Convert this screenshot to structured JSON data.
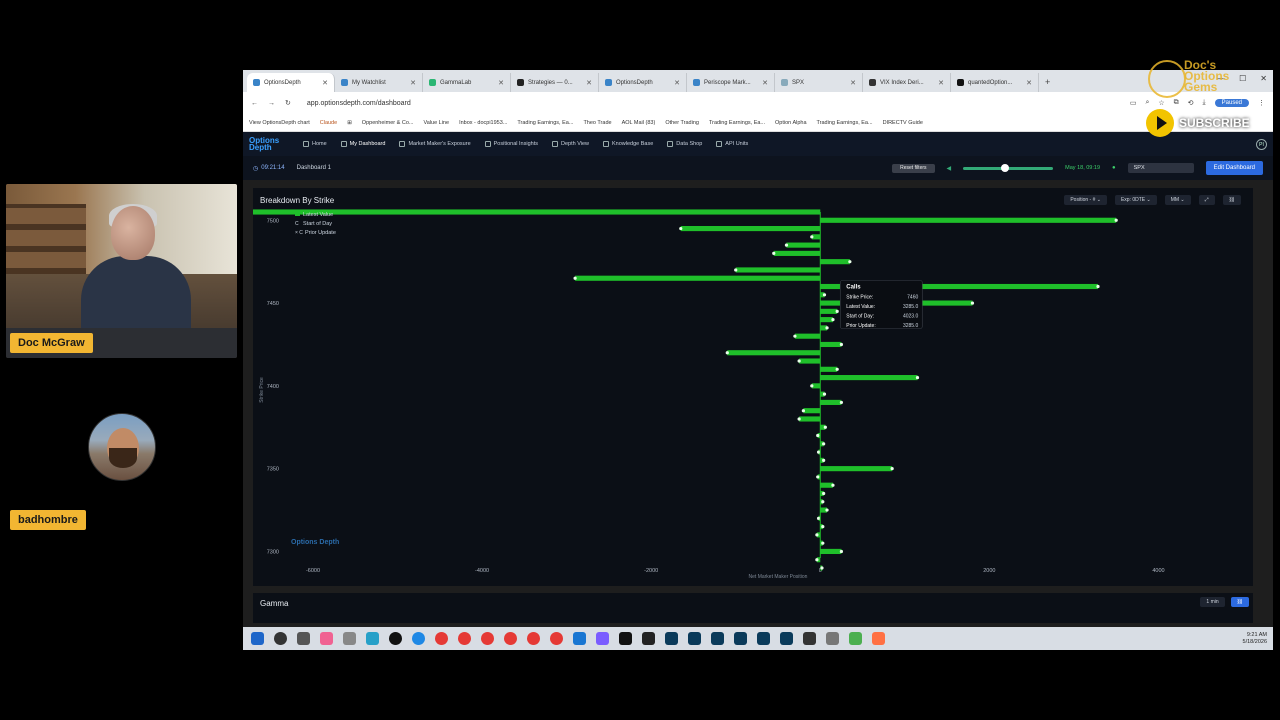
{
  "webcams": [
    {
      "name": "Doc McGraw"
    },
    {
      "name": "badhombre"
    }
  ],
  "browser": {
    "tabs": [
      {
        "label": "OptionsDepth",
        "active": true
      },
      {
        "label": "My Watchlist"
      },
      {
        "label": "GammaLab"
      },
      {
        "label": "Strategies — 0..."
      },
      {
        "label": "OptionsDepth"
      },
      {
        "label": "Periscope Mark..."
      },
      {
        "label": "SPX"
      },
      {
        "label": "VIX Index Deri..."
      },
      {
        "label": "quantedOption..."
      }
    ],
    "url": "app.optionsdepth.com/dashboard",
    "paused_label": "Paused",
    "bookmarks": [
      "View OptionsDepth chart",
      "Claude",
      "Oppenheimer & Co...",
      "Value Line",
      "Inbox - docpi1953...",
      "Trading Earnings, Ea...",
      "Theo Trade",
      "AOL Mail (83)",
      "Other Trading",
      "Trading Earnings, Ea...",
      "Option Alpha",
      "Trading Earnings, Ea...",
      "DIRECTV Guide"
    ]
  },
  "app": {
    "logo": "Options Depth",
    "nav": [
      "Home",
      "My Dashboard",
      "Market Maker's Exposure",
      "Positional Insights",
      "Depth View",
      "Knowledge Base",
      "Data Shop",
      "API Units"
    ],
    "active_nav": "My Dashboard",
    "time": "09:21:14",
    "dashboard": "Dashboard 1",
    "reset_label": "Reset filters",
    "date": "May 18, 09:19",
    "symbol": "SPX",
    "edit_label": "Edit Dashboard"
  },
  "panel": {
    "title": "Breakdown By Strike",
    "controls": [
      "Position - # ⌄",
      "Exp: 0DTE ⌄",
      "MM ⌄"
    ],
    "legend": [
      "Latest Value",
      "Start of Day",
      "Prior Update"
    ]
  },
  "chart_data": {
    "type": "bar",
    "orientation": "horizontal",
    "xlabel": "Net Market Maker Position",
    "ylabel": "Strike Price",
    "xlim": [
      -6000,
      5000
    ],
    "ylim": [
      7290,
      7505
    ],
    "x_ticks": [
      "-6000",
      "-4000",
      "-2000",
      "0",
      "2000",
      "4000"
    ],
    "y_ticks": [
      "7300",
      "7350",
      "7400",
      "7450",
      "7500"
    ],
    "series_colors": {
      "latest": "#1fbf2a",
      "marker": "#e8ffe8"
    },
    "bars": [
      {
        "strike": 7505,
        "value": -6900
      },
      {
        "strike": 7500,
        "value": 3500
      },
      {
        "strike": 7495,
        "value": -1650
      },
      {
        "strike": 7490,
        "value": -100
      },
      {
        "strike": 7485,
        "value": -400
      },
      {
        "strike": 7480,
        "value": -550
      },
      {
        "strike": 7475,
        "value": 350
      },
      {
        "strike": 7470,
        "value": -1000
      },
      {
        "strike": 7465,
        "value": -2900
      },
      {
        "strike": 7460,
        "value": 3285
      },
      {
        "strike": 7455,
        "value": 50
      },
      {
        "strike": 7450,
        "value": 1800
      },
      {
        "strike": 7445,
        "value": 200
      },
      {
        "strike": 7440,
        "value": 150
      },
      {
        "strike": 7435,
        "value": 80
      },
      {
        "strike": 7430,
        "value": -300
      },
      {
        "strike": 7425,
        "value": 250
      },
      {
        "strike": 7420,
        "value": -1100
      },
      {
        "strike": 7415,
        "value": -250
      },
      {
        "strike": 7410,
        "value": 200
      },
      {
        "strike": 7405,
        "value": 1150
      },
      {
        "strike": 7400,
        "value": -100
      },
      {
        "strike": 7395,
        "value": 50
      },
      {
        "strike": 7390,
        "value": 250
      },
      {
        "strike": 7385,
        "value": -200
      },
      {
        "strike": 7380,
        "value": -250
      },
      {
        "strike": 7375,
        "value": 60
      },
      {
        "strike": 7370,
        "value": -30
      },
      {
        "strike": 7365,
        "value": 40
      },
      {
        "strike": 7360,
        "value": -20
      },
      {
        "strike": 7355,
        "value": 40
      },
      {
        "strike": 7350,
        "value": 850
      },
      {
        "strike": 7345,
        "value": -30
      },
      {
        "strike": 7340,
        "value": 150
      },
      {
        "strike": 7335,
        "value": 40
      },
      {
        "strike": 7330,
        "value": 30
      },
      {
        "strike": 7325,
        "value": 80
      },
      {
        "strike": 7320,
        "value": -20
      },
      {
        "strike": 7315,
        "value": 30
      },
      {
        "strike": 7310,
        "value": -40
      },
      {
        "strike": 7305,
        "value": 30
      },
      {
        "strike": 7300,
        "value": 250
      },
      {
        "strike": 7295,
        "value": -40
      },
      {
        "strike": 7290,
        "value": 20
      }
    ],
    "tooltip": {
      "title": "Calls",
      "rows": [
        {
          "label": "Strike Price:",
          "value": "7460"
        },
        {
          "label": "Latest Value:",
          "value": "3285.0"
        },
        {
          "label": "Start of Day:",
          "value": "4023.0"
        },
        {
          "label": "Prior Update:",
          "value": "3285.0"
        }
      ]
    }
  },
  "gamma": {
    "title": "Gamma",
    "interval": "1 min"
  },
  "taskbar": {
    "time": "9:21 AM",
    "date": "5/18/2026"
  },
  "overlay": {
    "subscribe": "SUBSCRIBE",
    "brand": "Doc's Options Gems"
  }
}
